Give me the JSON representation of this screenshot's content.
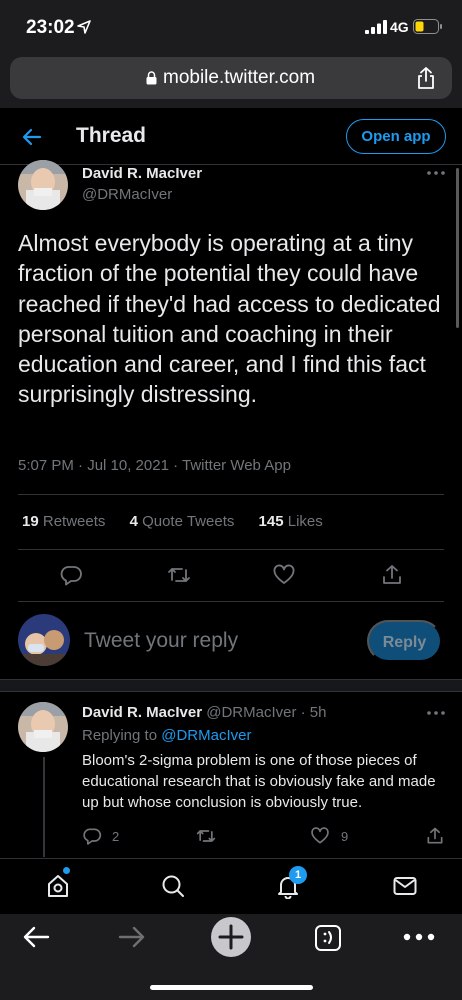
{
  "status_bar": {
    "time": "23:02",
    "network": "4G"
  },
  "browser": {
    "url": "mobile.twitter.com"
  },
  "header": {
    "title": "Thread",
    "open_app_label": "Open app"
  },
  "main_tweet": {
    "author_name": "David R. MacIver",
    "author_handle": "@DRMacIver",
    "text": "Almost everybody is operating at a tiny fraction of the potential they could have reached if they'd had access to dedicated personal tuition and coaching in their education and career, and I find this fact surprisingly distressing.",
    "meta": "5:07 PM · Jul 10, 2021 · Twitter Web App",
    "stats": {
      "retweets_count": "19",
      "retweets_label": "Retweets",
      "quotes_count": "4",
      "quotes_label": "Quote Tweets",
      "likes_count": "145",
      "likes_label": "Likes"
    }
  },
  "composer": {
    "placeholder": "Tweet your reply",
    "reply_label": "Reply"
  },
  "reply_tweet": {
    "author_name": "David R. MacIver",
    "author_handle": "@DRMacIver",
    "age": "· 5h",
    "replying_prefix": "Replying to",
    "replying_mention": "@DRMacIver",
    "text": "Bloom's 2-sigma problem is one of those pieces of educational research that is obviously fake and made up but whose conclusion is obviously true.",
    "reply_count": "2",
    "like_count": "9"
  },
  "bottom_nav": {
    "notifications_badge": "1"
  },
  "colors": {
    "accent": "#1d9bf0",
    "background": "#000000",
    "muted": "#71767b"
  },
  "icons": [
    "location-arrow-icon",
    "signal-icon",
    "battery-icon",
    "lock-icon",
    "share-icon",
    "back-arrow-icon",
    "more-dots-icon",
    "reply-icon",
    "retweet-icon",
    "like-icon",
    "share-tweet-icon",
    "home-icon",
    "explore-icon",
    "notifications-icon",
    "messages-icon",
    "browser-back-icon",
    "browser-forward-icon",
    "new-tab-icon",
    "tabs-icon",
    "browser-menu-icon"
  ]
}
